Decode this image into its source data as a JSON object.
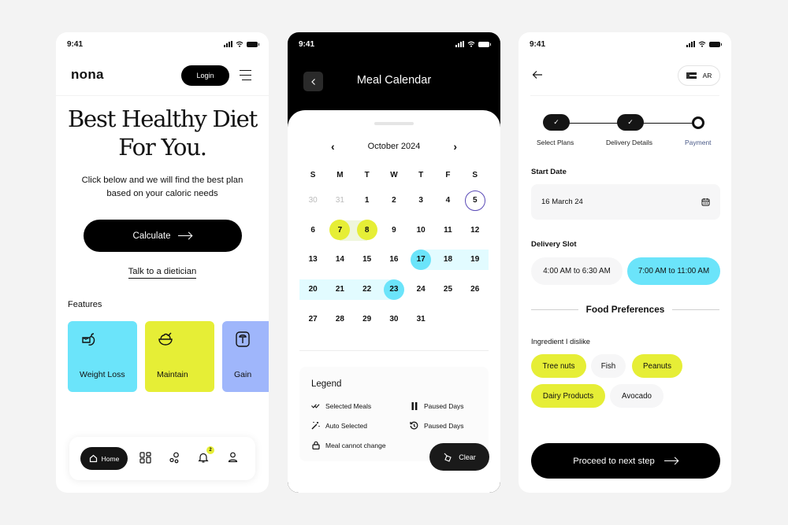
{
  "status_bar": {
    "time": "9:41"
  },
  "home": {
    "brand": "nona",
    "login_label": "Login",
    "hero_line1": "Best Healthy Diet",
    "hero_line2": "For You.",
    "subtitle_line1": "Click below and we will find the best plan",
    "subtitle_line2": "based on your caloric needs",
    "calculate_label": "Calculate",
    "talk_link": "Talk to a dietician",
    "features_label": "Features",
    "features": [
      {
        "label": "Weight Loss",
        "icon": "weighted-apple-icon",
        "color": "#6be4fa"
      },
      {
        "label": "Maintain",
        "icon": "salad-bowl-icon",
        "color": "#e6ee36"
      },
      {
        "label": "Gain",
        "icon": "scale-icon",
        "color": "#9fb6fb"
      }
    ],
    "nav": {
      "home_label": "Home",
      "notification_count": "2"
    }
  },
  "calendar": {
    "title": "Meal Calendar",
    "month": "October 2024",
    "weekdays": [
      "S",
      "M",
      "T",
      "W",
      "T",
      "F",
      "S"
    ],
    "weeks": [
      [
        "30",
        "31",
        "1",
        "2",
        "3",
        "4",
        "5"
      ],
      [
        "6",
        "7",
        "8",
        "9",
        "10",
        "11",
        "12"
      ],
      [
        "13",
        "14",
        "15",
        "16",
        "17",
        "18",
        "19"
      ],
      [
        "20",
        "21",
        "22",
        "23",
        "24",
        "25",
        "26"
      ],
      [
        "27",
        "28",
        "29",
        "30",
        "31",
        "",
        ""
      ]
    ],
    "muted_days": [
      "30",
      "31"
    ],
    "today": "5",
    "selected_meals": [
      "7",
      "8"
    ],
    "range_start": "17",
    "range_end": "23",
    "legend_title": "Legend",
    "legend": [
      {
        "label": "Selected Meals",
        "icon": "double-check-icon"
      },
      {
        "label": "Paused Days",
        "icon": "pause-icon"
      },
      {
        "label": "Auto Selected",
        "icon": "magic-wand-icon"
      },
      {
        "label": "Paused Days",
        "icon": "history-icon"
      },
      {
        "label": "Meal cannot change",
        "icon": "lock-icon"
      }
    ],
    "clear_label": "Clear",
    "colors": {
      "selected": "#e6ee36",
      "range": "#6be4fa",
      "today_ring": "#5b4bb7"
    }
  },
  "checkout": {
    "lang_label": "AR",
    "steps": [
      {
        "label": "Select Plans",
        "state": "done"
      },
      {
        "label": "Delivery Details",
        "state": "done"
      },
      {
        "label": "Payment",
        "state": "current"
      }
    ],
    "start_date_label": "Start Date",
    "start_date_value": "16 March 24",
    "delivery_slot_label": "Delivery Slot",
    "slots": [
      {
        "label": "4:00 AM to 6:30 AM",
        "selected": false
      },
      {
        "label": "7:00 AM to 11:00 AM",
        "selected": true
      }
    ],
    "food_pref_title": "Food Preferences",
    "dislike_label": "Ingredient I dislike",
    "ingredients": [
      {
        "label": "Tree nuts",
        "selected": true
      },
      {
        "label": "Fish",
        "selected": false
      },
      {
        "label": "Peanuts",
        "selected": true
      },
      {
        "label": "Dairy Products",
        "selected": true
      },
      {
        "label": "Avocado",
        "selected": false
      }
    ],
    "proceed_label": "Proceed to next step"
  }
}
